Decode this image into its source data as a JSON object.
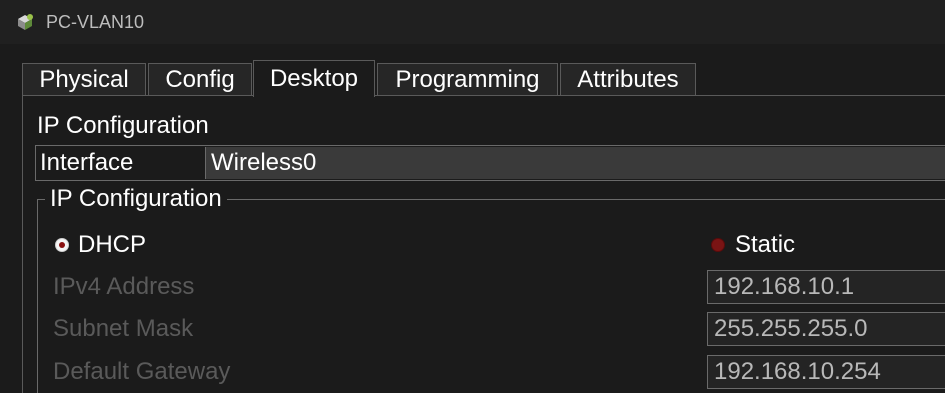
{
  "window": {
    "title": "PC-VLAN10",
    "icon": "pc-device-icon"
  },
  "tabs": [
    {
      "label": "Physical",
      "active": false
    },
    {
      "label": "Config",
      "active": false
    },
    {
      "label": "Desktop",
      "active": true
    },
    {
      "label": "Programming",
      "active": false
    },
    {
      "label": "Attributes",
      "active": false
    }
  ],
  "ip_config": {
    "section_title": "IP Configuration",
    "interface_label": "Interface",
    "interface_value": "Wireless0",
    "group_title": "IP Configuration",
    "dhcp_label": "DHCP",
    "static_label": "Static",
    "selected_mode": "DHCP",
    "fields": [
      {
        "label": "IPv4 Address",
        "value": "192.168.10.1"
      },
      {
        "label": "Subnet Mask",
        "value": "255.255.255.0"
      },
      {
        "label": "Default Gateway",
        "value": "192.168.10.254"
      }
    ]
  },
  "colors": {
    "background": "#1b1b1b",
    "radio_selected_dot": "#8a1010",
    "radio_unselected": "#7a1414",
    "disabled_label": "#5a5a5a"
  }
}
